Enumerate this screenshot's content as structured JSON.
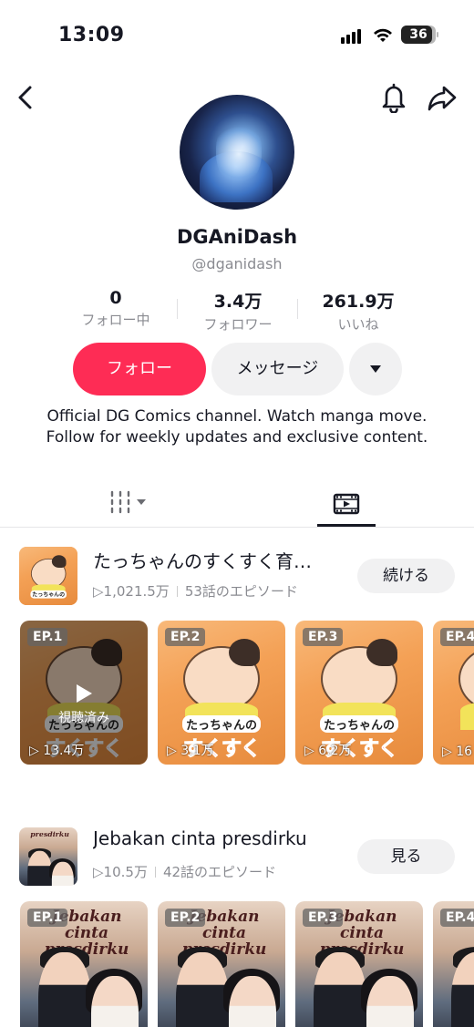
{
  "status_bar": {
    "time": "13:09",
    "battery": "36"
  },
  "profile": {
    "display_name": "DGAniDash",
    "handle": "@dganidash",
    "stats": [
      {
        "value": "0",
        "label": "フォロー中"
      },
      {
        "value": "3.4万",
        "label": "フォロワー"
      },
      {
        "value": "261.9万",
        "label": "いいね"
      }
    ],
    "follow_label": "フォロー",
    "message_label": "メッセージ",
    "bio": "Official DG Comics channel. Watch manga move. Follow for weekly updates and exclusive content."
  },
  "colors": {
    "accent": "#fe2c55",
    "secondary_bg": "#f1f1f2",
    "muted_text": "#8a8b91"
  },
  "tabs": [
    {
      "icon": "grid-icon",
      "active": false
    },
    {
      "icon": "playlist-icon",
      "active": true
    }
  ],
  "series": [
    {
      "title": "たっちゃんのすくすく育…",
      "views": "1,021.5万",
      "episodes": "53話のエピソード",
      "action_label": "続ける",
      "cover_text": [
        "たっちゃんの",
        "すくすく"
      ],
      "episode_cards": [
        {
          "badge": "EP.1",
          "views": "13.4万",
          "watched": "視聴済み"
        },
        {
          "badge": "EP.2",
          "views": "3.1万"
        },
        {
          "badge": "EP.3",
          "views": "6.2万"
        },
        {
          "badge": "EP.4",
          "views": "16"
        }
      ]
    },
    {
      "title": "Jebakan cinta presdirku",
      "views": "10.5万",
      "episodes": "42話のエピソード",
      "action_label": "見る",
      "cover_text": [
        "Jebakan cinta",
        "presdirku"
      ],
      "episode_cards": [
        {
          "badge": "EP.1"
        },
        {
          "badge": "EP.2"
        },
        {
          "badge": "EP.3"
        },
        {
          "badge": "EP.4"
        }
      ]
    }
  ]
}
